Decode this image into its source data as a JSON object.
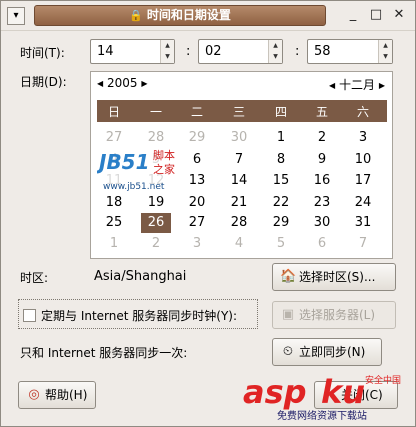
{
  "window": {
    "title": "时间和日期设置",
    "title_icon": "lock-icon",
    "menu_glyph": "▾",
    "min_glyph": "_",
    "max_glyph": "□",
    "close_glyph": "✕"
  },
  "time": {
    "label": "时间(T):",
    "hour": "14",
    "minute": "02",
    "second": "58",
    "separator": ":"
  },
  "date": {
    "label": "日期(D):",
    "year": "2005",
    "month": "十二月",
    "weekdays": [
      "日",
      "一",
      "二",
      "三",
      "四",
      "五",
      "六"
    ],
    "weeks": [
      [
        "27",
        "28",
        "29",
        "30",
        "1",
        "2",
        "3"
      ],
      [
        "4",
        "5",
        "6",
        "7",
        "8",
        "9",
        "10"
      ],
      [
        "11",
        "12",
        "13",
        "14",
        "15",
        "16",
        "17"
      ],
      [
        "18",
        "19",
        "20",
        "21",
        "22",
        "23",
        "24"
      ],
      [
        "25",
        "26",
        "27",
        "28",
        "29",
        "30",
        "31"
      ],
      [
        "1",
        "2",
        "3",
        "4",
        "5",
        "6",
        "7"
      ]
    ],
    "selected_day": "26"
  },
  "timezone": {
    "label": "时区:",
    "value": "Asia/Shanghai",
    "button": "选择时区(S)..."
  },
  "sync": {
    "checkbox_label": "定期与 Internet 服务器同步时钟(Y):",
    "checked": false,
    "select_server_button": "选择服务器(L)",
    "once_label": "只和 Internet 服务器同步一次:",
    "sync_now_button": "立即同步(N)"
  },
  "footer": {
    "help_button": "帮助(H)",
    "close_button": "关闭(C)"
  },
  "logo": {
    "text": "JB51",
    "side1": "脚本",
    "side2": "之家",
    "url": "www.jb51.net"
  },
  "watermark": {
    "text": "asp",
    "text2": "ku",
    "sub": "安全中国",
    "tagline": "免费网络资源下载站"
  },
  "colors": {
    "accent": "#7b5a45",
    "title_gradient": "#a37555"
  }
}
